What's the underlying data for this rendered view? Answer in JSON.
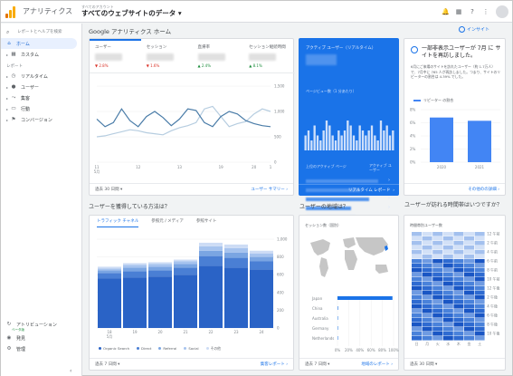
{
  "header": {
    "app_title": "アナリティクス",
    "account_label": "すべてのアカウント",
    "property": "すべてのウェブサイトのデータ"
  },
  "sidebar": {
    "search_placeholder": "レポートとヘルプを検索",
    "items": [
      {
        "label": "ホーム",
        "icon": "home-icon",
        "active": true
      },
      {
        "label": "カスタム",
        "icon": "grid-icon",
        "active": false
      }
    ],
    "reports_label": "レポート",
    "report_items": [
      {
        "label": "リアルタイム",
        "icon": "clock-icon"
      },
      {
        "label": "ユーザー",
        "icon": "user-icon"
      },
      {
        "label": "集客",
        "icon": "acquisition-icon"
      },
      {
        "label": "行動",
        "icon": "behavior-icon"
      },
      {
        "label": "コンバージョン",
        "icon": "flag-icon"
      }
    ],
    "bottom_items": [
      {
        "label": "アトリビューション",
        "icon": "attribution-icon",
        "badge": "ベータ版"
      },
      {
        "label": "発見",
        "icon": "discover-icon"
      },
      {
        "label": "管理",
        "icon": "gear-icon"
      }
    ]
  },
  "home": {
    "title": "Google アナリティクス ホーム",
    "insight_label": "インサイト"
  },
  "overview": {
    "tabs": [
      {
        "label": "ユーザー",
        "delta": "▼ 2.8%",
        "dir": "down"
      },
      {
        "label": "セッション",
        "delta": "▼ 1.6%",
        "dir": "down"
      },
      {
        "label": "直帰率",
        "delta": "▲ 2.4%",
        "dir": "up"
      },
      {
        "label": "セッション継続時間",
        "delta": "▲ 8.1%",
        "dir": "up"
      }
    ],
    "y_ticks": [
      "1,500",
      "1,000",
      "500",
      "0"
    ],
    "x_ticks": [
      "11\n5月",
      "12",
      "13",
      "19",
      "20",
      "1"
    ],
    "footer_range": "過去 30 日間",
    "footer_link": "ユーザー サマリー"
  },
  "realtime": {
    "title": "アクティブ ユーザー（リアルタイム）",
    "sub": "ページビュー数（1 分あたり）",
    "col1": "上位のアクティブ ページ",
    "col2": "アクティブ ユーザー",
    "footer_link": "リアルタイム レポート"
  },
  "insight_card": {
    "title": "一部非表示ユーザーが 7月 に サイトを再訪しました。",
    "body": "6月にご来場のサイトを訪れたユーザー（約 1.7万人）で、7月中に 765 人が再訪しました。つまり、サイトのリピーターの割合は 4.39% でした。",
    "legend": "リピーター の割合",
    "y_ticks": [
      "8%",
      "6%",
      "4%",
      "2%",
      "0%"
    ],
    "x_ticks": [
      "2020",
      "2021"
    ],
    "footer_link": "その他のの詳細"
  },
  "acquisition": {
    "title": "ユーザーを獲得している方法は？",
    "tabs": [
      "トラフィック チャネル",
      "参照元 / メディア",
      "参照サイト"
    ],
    "y_ticks": [
      "1,000",
      "800",
      "600",
      "400",
      "200",
      "0"
    ],
    "x_ticks": [
      "18\n5月",
      "19",
      "20",
      "21",
      "22",
      "23",
      "24"
    ],
    "legend": [
      "Organic Search",
      "Direct",
      "Referral",
      "Social",
      "その他"
    ],
    "footer_range": "過去 7 日間",
    "footer_link": "集客レポート"
  },
  "geo": {
    "title": "ユーザーの地域は？",
    "label": "セッション数（国別）",
    "countries": [
      "Japan",
      "China",
      "Australia",
      "Germany",
      "Netherlands"
    ],
    "x_ticks": [
      "0%",
      "20%",
      "40%",
      "60%",
      "80%",
      "100%"
    ],
    "footer_range": "過去 7 日間",
    "footer_link": "地域のレポート"
  },
  "hours": {
    "title": "ユーザーが訪れる時間帯はいつですか？",
    "label": "時間帯別ユーザー数",
    "y_ticks": [
      "12 午前",
      "2 午前",
      "4 午前",
      "6 午前",
      "8 午前",
      "10 午前",
      "12 午後",
      "2 午後",
      "4 午後",
      "6 午後",
      "8 午後",
      "10 午後"
    ],
    "x_ticks": [
      "日",
      "月",
      "火",
      "水",
      "木",
      "金",
      "土"
    ],
    "footer_range": "過去 30 日間"
  },
  "chart_data": [
    {
      "type": "line",
      "x": [
        "11 5月",
        "12",
        "13",
        "14",
        "15",
        "16",
        "17",
        "18",
        "19",
        "20",
        "21",
        "22",
        "23",
        "24",
        "25",
        "26",
        "27",
        "28",
        "29",
        "30",
        "31",
        "1"
      ],
      "series": [
        {
          "values": [
            850,
            700,
            780,
            1050,
            820,
            700,
            900,
            1000,
            880,
            720,
            850,
            1050,
            1020,
            780,
            700,
            900,
            1000,
            950,
            820,
            760,
            720,
            700
          ]
        },
        {
          "values": [
            500,
            520,
            560,
            600,
            640,
            620,
            580,
            560,
            540,
            620,
            680,
            720,
            780,
            1050,
            1100,
            900,
            700,
            760,
            800,
            950,
            1050,
            1000
          ]
        }
      ],
      "ylim": [
        0,
        1500
      ]
    },
    {
      "type": "bar",
      "values": [
        3,
        4,
        2,
        5,
        3,
        2,
        4,
        6,
        5,
        3,
        2,
        4,
        3,
        4,
        6,
        5,
        3,
        2,
        5,
        4,
        3,
        4,
        5,
        3,
        2,
        6,
        4,
        5,
        3,
        4
      ]
    },
    {
      "type": "bar",
      "categories": [
        "2020",
        "2021"
      ],
      "values": [
        6.8,
        6.3
      ],
      "ylim": [
        0,
        8
      ]
    },
    {
      "type": "bar",
      "categories": [
        "18 5月",
        "19",
        "20",
        "21",
        "22",
        "23",
        "24"
      ],
      "series": [
        {
          "name": "Organic Search",
          "values": [
            560,
            570,
            580,
            600,
            700,
            680,
            660
          ]
        },
        {
          "name": "Direct",
          "values": [
            60,
            70,
            70,
            80,
            110,
            110,
            90
          ]
        },
        {
          "name": "Referral",
          "values": [
            30,
            40,
            40,
            40,
            60,
            60,
            50
          ]
        },
        {
          "name": "Social",
          "values": [
            20,
            30,
            30,
            30,
            50,
            50,
            40
          ]
        },
        {
          "name": "その他",
          "values": [
            20,
            20,
            20,
            20,
            40,
            40,
            30
          ]
        }
      ],
      "ylim": [
        0,
        1000
      ]
    },
    {
      "type": "bar",
      "categories": [
        "Japan",
        "China",
        "Australia",
        "Germany",
        "Netherlands"
      ],
      "values": [
        98,
        1,
        0.5,
        0.3,
        0.2
      ],
      "ylim": [
        0,
        100
      ]
    }
  ],
  "colors": {
    "accent": "#1a73e8",
    "bar_dark": "#2a63c6",
    "bar_mid": "#4a7fd4",
    "bar_light": "#7aa5e2",
    "bar_lighter": "#a6c3ee",
    "line1": "#4a7ca8",
    "line2": "#b6cde0"
  }
}
